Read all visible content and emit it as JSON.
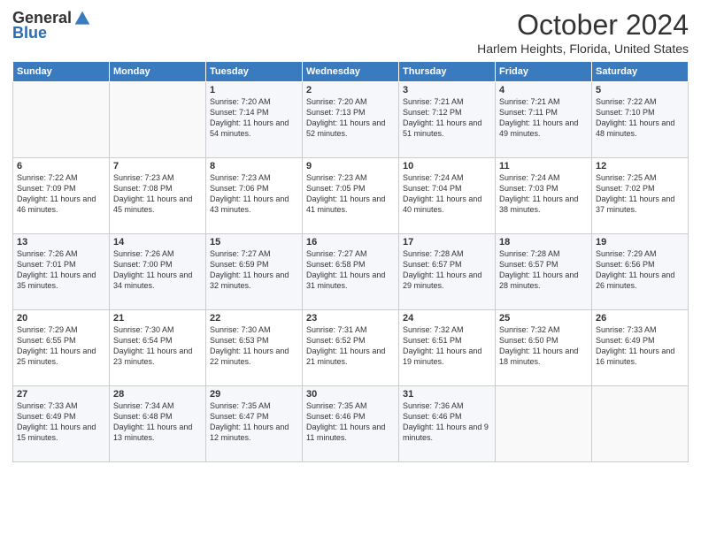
{
  "header": {
    "logo_general": "General",
    "logo_blue": "Blue",
    "title": "October 2024",
    "subtitle": "Harlem Heights, Florida, United States"
  },
  "days_of_week": [
    "Sunday",
    "Monday",
    "Tuesday",
    "Wednesday",
    "Thursday",
    "Friday",
    "Saturday"
  ],
  "weeks": [
    [
      {
        "day": "",
        "text": ""
      },
      {
        "day": "",
        "text": ""
      },
      {
        "day": "1",
        "text": "Sunrise: 7:20 AM\nSunset: 7:14 PM\nDaylight: 11 hours and 54 minutes."
      },
      {
        "day": "2",
        "text": "Sunrise: 7:20 AM\nSunset: 7:13 PM\nDaylight: 11 hours and 52 minutes."
      },
      {
        "day": "3",
        "text": "Sunrise: 7:21 AM\nSunset: 7:12 PM\nDaylight: 11 hours and 51 minutes."
      },
      {
        "day": "4",
        "text": "Sunrise: 7:21 AM\nSunset: 7:11 PM\nDaylight: 11 hours and 49 minutes."
      },
      {
        "day": "5",
        "text": "Sunrise: 7:22 AM\nSunset: 7:10 PM\nDaylight: 11 hours and 48 minutes."
      }
    ],
    [
      {
        "day": "6",
        "text": "Sunrise: 7:22 AM\nSunset: 7:09 PM\nDaylight: 11 hours and 46 minutes."
      },
      {
        "day": "7",
        "text": "Sunrise: 7:23 AM\nSunset: 7:08 PM\nDaylight: 11 hours and 45 minutes."
      },
      {
        "day": "8",
        "text": "Sunrise: 7:23 AM\nSunset: 7:06 PM\nDaylight: 11 hours and 43 minutes."
      },
      {
        "day": "9",
        "text": "Sunrise: 7:23 AM\nSunset: 7:05 PM\nDaylight: 11 hours and 41 minutes."
      },
      {
        "day": "10",
        "text": "Sunrise: 7:24 AM\nSunset: 7:04 PM\nDaylight: 11 hours and 40 minutes."
      },
      {
        "day": "11",
        "text": "Sunrise: 7:24 AM\nSunset: 7:03 PM\nDaylight: 11 hours and 38 minutes."
      },
      {
        "day": "12",
        "text": "Sunrise: 7:25 AM\nSunset: 7:02 PM\nDaylight: 11 hours and 37 minutes."
      }
    ],
    [
      {
        "day": "13",
        "text": "Sunrise: 7:26 AM\nSunset: 7:01 PM\nDaylight: 11 hours and 35 minutes."
      },
      {
        "day": "14",
        "text": "Sunrise: 7:26 AM\nSunset: 7:00 PM\nDaylight: 11 hours and 34 minutes."
      },
      {
        "day": "15",
        "text": "Sunrise: 7:27 AM\nSunset: 6:59 PM\nDaylight: 11 hours and 32 minutes."
      },
      {
        "day": "16",
        "text": "Sunrise: 7:27 AM\nSunset: 6:58 PM\nDaylight: 11 hours and 31 minutes."
      },
      {
        "day": "17",
        "text": "Sunrise: 7:28 AM\nSunset: 6:57 PM\nDaylight: 11 hours and 29 minutes."
      },
      {
        "day": "18",
        "text": "Sunrise: 7:28 AM\nSunset: 6:57 PM\nDaylight: 11 hours and 28 minutes."
      },
      {
        "day": "19",
        "text": "Sunrise: 7:29 AM\nSunset: 6:56 PM\nDaylight: 11 hours and 26 minutes."
      }
    ],
    [
      {
        "day": "20",
        "text": "Sunrise: 7:29 AM\nSunset: 6:55 PM\nDaylight: 11 hours and 25 minutes."
      },
      {
        "day": "21",
        "text": "Sunrise: 7:30 AM\nSunset: 6:54 PM\nDaylight: 11 hours and 23 minutes."
      },
      {
        "day": "22",
        "text": "Sunrise: 7:30 AM\nSunset: 6:53 PM\nDaylight: 11 hours and 22 minutes."
      },
      {
        "day": "23",
        "text": "Sunrise: 7:31 AM\nSunset: 6:52 PM\nDaylight: 11 hours and 21 minutes."
      },
      {
        "day": "24",
        "text": "Sunrise: 7:32 AM\nSunset: 6:51 PM\nDaylight: 11 hours and 19 minutes."
      },
      {
        "day": "25",
        "text": "Sunrise: 7:32 AM\nSunset: 6:50 PM\nDaylight: 11 hours and 18 minutes."
      },
      {
        "day": "26",
        "text": "Sunrise: 7:33 AM\nSunset: 6:49 PM\nDaylight: 11 hours and 16 minutes."
      }
    ],
    [
      {
        "day": "27",
        "text": "Sunrise: 7:33 AM\nSunset: 6:49 PM\nDaylight: 11 hours and 15 minutes."
      },
      {
        "day": "28",
        "text": "Sunrise: 7:34 AM\nSunset: 6:48 PM\nDaylight: 11 hours and 13 minutes."
      },
      {
        "day": "29",
        "text": "Sunrise: 7:35 AM\nSunset: 6:47 PM\nDaylight: 11 hours and 12 minutes."
      },
      {
        "day": "30",
        "text": "Sunrise: 7:35 AM\nSunset: 6:46 PM\nDaylight: 11 hours and 11 minutes."
      },
      {
        "day": "31",
        "text": "Sunrise: 7:36 AM\nSunset: 6:46 PM\nDaylight: 11 hours and 9 minutes."
      },
      {
        "day": "",
        "text": ""
      },
      {
        "day": "",
        "text": ""
      }
    ]
  ]
}
